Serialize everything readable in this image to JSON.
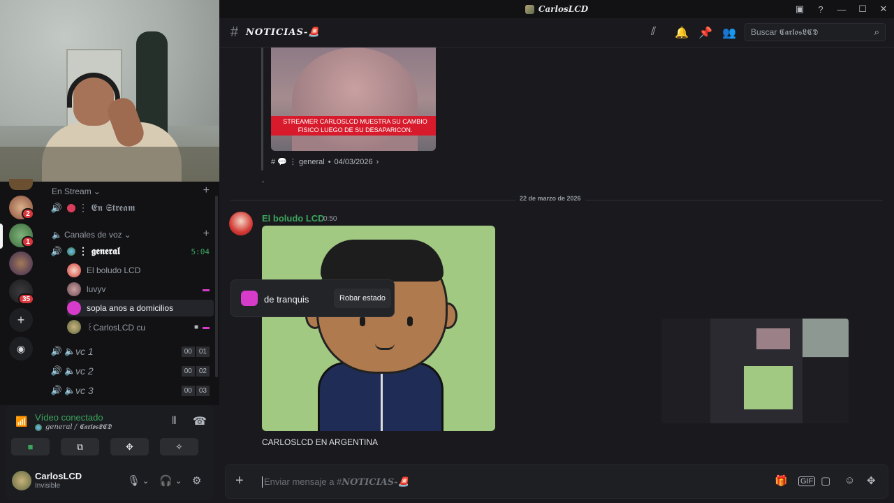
{
  "window": {
    "title": "CarlosLCD"
  },
  "rail": {
    "badges": [
      "2",
      "1",
      "35"
    ]
  },
  "sidebar": {
    "stream_category": "En Stream",
    "stream_channel": "⋮ 𝕰𝖓 𝕾𝖙𝖗𝖊𝖆𝖒",
    "voice_category": "Canales de voz",
    "general": {
      "name": "⋮ 𝖌𝖊𝖓𝖊𝖗𝖆𝖑",
      "timer": "5:04"
    },
    "members": [
      {
        "name": "El boludo LCD",
        "color": "#d43a35"
      },
      {
        "name": "luvyv",
        "color": "#8a6a6f"
      },
      {
        "name": "sopla anos a domicilios",
        "color": "#d63cc9"
      },
      {
        "name": "꒰CarlosLCD cu",
        "color": "#a89a6a"
      }
    ],
    "vc_channels": [
      {
        "name": "vc 1",
        "count": "00",
        "limit": "01"
      },
      {
        "name": "vc 2",
        "count": "00",
        "limit": "02"
      },
      {
        "name": "vc 3",
        "count": "00",
        "limit": "03"
      }
    ]
  },
  "voice_panel": {
    "title": "Vídeo conectado",
    "subtitle": "general / 𝕮𝖆𝖗𝖑𝖔𝖘𝕷𝕮𝕯"
  },
  "user": {
    "name": "CarlosLCD",
    "status": "Invisible"
  },
  "header": {
    "channel": "𝑵𝑶𝑻𝑰𝑪𝑰𝑨𝑺-🚨",
    "search_placeholder": "Buscar 𝕮𝖆𝖗𝖑𝖔𝖘𝕷𝕮𝕯"
  },
  "messages": {
    "top_banner": "STREAMER CARLOSLCD MUESTRA SU CAMBIO FISICO LUEGO DE SU DESAPARICON.",
    "thread_channel": "# 💬 ⋮ general",
    "thread_date": "04/03/2026",
    "dot": ".",
    "date_divider": "22 de marzo de 2026",
    "author": "El boludo LCD",
    "time": "0:50",
    "caption": "CARLOSLCD EN ARGENTINA"
  },
  "status_popup": {
    "text": "de tranquis",
    "button": "Robar estado"
  },
  "composer": {
    "prefix": "Enviar mensaje a #",
    "channel": "𝑵𝑶𝑻𝑰𝑪𝑰𝑨𝑺-🚨"
  }
}
